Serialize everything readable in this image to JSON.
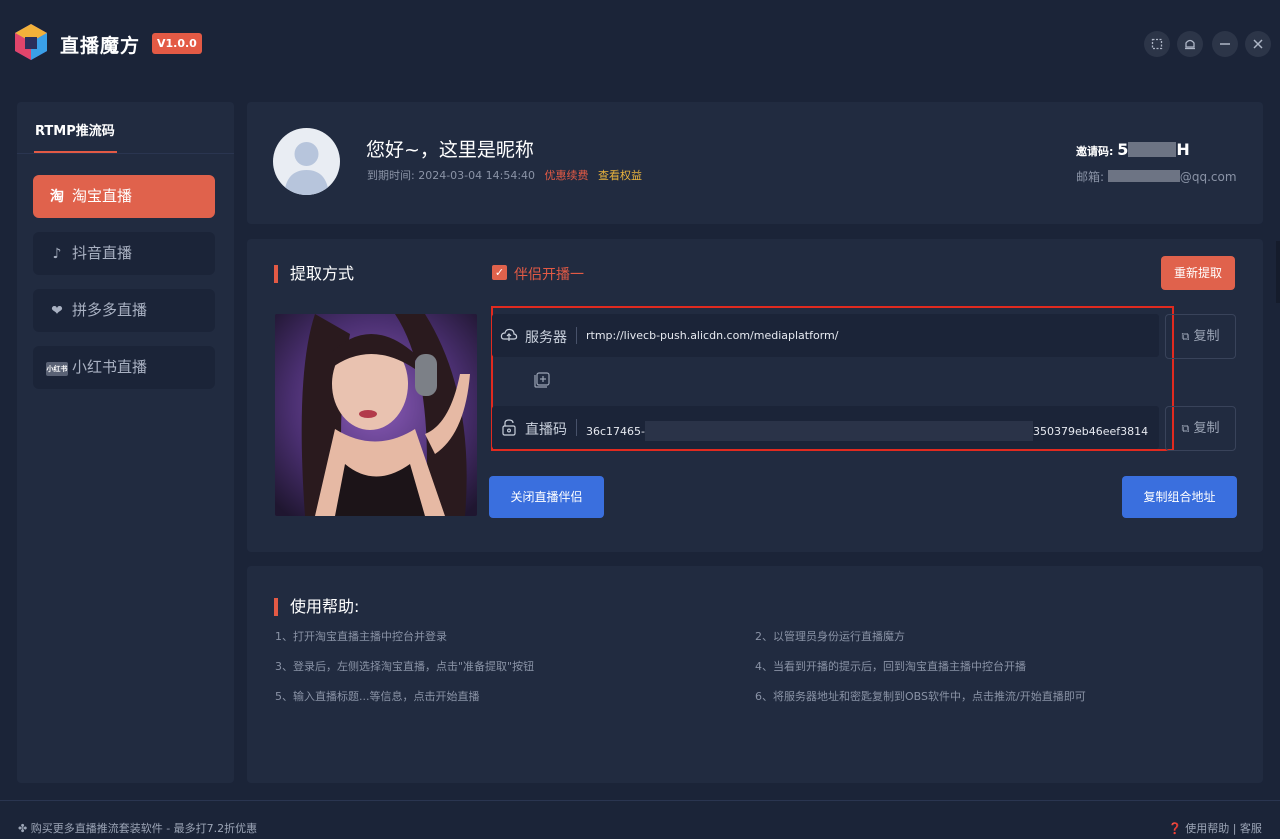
{
  "app": {
    "name": "直播魔方",
    "version": "V1.0.0"
  },
  "window_controls": [
    "pin-icon",
    "notify-icon",
    "minimize-icon",
    "close-icon"
  ],
  "sidebar": {
    "tab": "RTMP推流码",
    "items": [
      {
        "label": "淘宝直播",
        "icon": "taobao-icon",
        "icon_text": "淘",
        "active": true
      },
      {
        "label": "抖音直播",
        "icon": "douyin-icon",
        "icon_text": "♪",
        "active": false
      },
      {
        "label": "拼多多直播",
        "icon": "pinduoduo-icon",
        "icon_text": "❤",
        "active": false
      },
      {
        "label": "小红书直播",
        "icon": "xiaohongshu-icon",
        "icon_text": "小红书",
        "active": false
      }
    ]
  },
  "profile": {
    "greeting": "您好~，这里是昵称",
    "expire_label": "到期时间: 2024-03-04 14:54:40",
    "renew": "优惠续费",
    "rights": "查看权益",
    "invite_label": "邀请码: ",
    "invite_prefix": "5",
    "invite_suffix": "H",
    "email_label": "邮箱: ",
    "email_suffix": "@qq.com"
  },
  "extract": {
    "title": "提取方式",
    "checkbox_label": "伴侣开播一",
    "checkbox_checked": true,
    "refetch": "重新提取",
    "server_label": "服务器",
    "server_value": "rtmp://livecb-push.alicdn.com/mediaplatform/",
    "key_label": "直播码",
    "key_prefix": "36c17465-",
    "key_suffix": "350379eb46eef3814",
    "copy": "复制",
    "close_companion": "关闭直播伴侣",
    "copy_combined": "复制组合地址"
  },
  "help": {
    "title": "使用帮助:",
    "items": [
      "1、打开淘宝直播主播中控台并登录",
      "2、以管理员身份运行直播魔方",
      "3、登录后，左侧选择淘宝直播，点击\"准备提取\"按钮",
      "4、当看到开播的提示后，回到淘宝直播主播中控台开播",
      "5、输入直播标题...等信息，点击开始直播",
      "6、将服务器地址和密匙复制到OBS软件中，点击推流/开始直播即可"
    ]
  },
  "footer": {
    "promo": "购买更多直播推流套装软件 - 最多打7.2折优惠",
    "help": "使用帮助",
    "separator": "|",
    "service": "客服"
  },
  "colors": {
    "background": "#1b2438",
    "panel": "#212b40",
    "accent": "#e0624c",
    "primary": "#3a6fde",
    "highlight_outline": "#e12a1f"
  }
}
